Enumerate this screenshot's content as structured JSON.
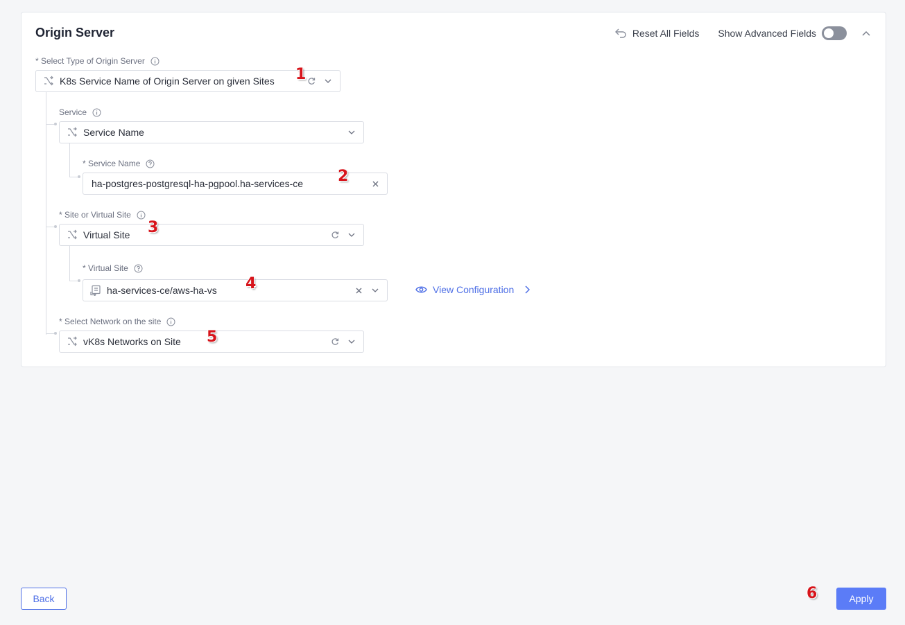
{
  "section": {
    "title": "Origin Server",
    "reset_label": "Reset All Fields",
    "advanced_label": "Show Advanced Fields",
    "advanced_enabled": false
  },
  "fields": {
    "origin_type": {
      "label": "* Select Type of Origin Server",
      "value": "K8s Service Name of Origin Server on given Sites"
    },
    "service": {
      "label": "Service",
      "value": "Service Name"
    },
    "service_name": {
      "label": "* Service Name",
      "value": "ha-postgres-postgresql-ha-pgpool.ha-services-ce"
    },
    "site_or_virtual": {
      "label": "* Site or Virtual Site",
      "value": "Virtual Site"
    },
    "virtual_site": {
      "label": "* Virtual Site",
      "value": "ha-services-ce/aws-ha-vs",
      "view_config_label": "View Configuration"
    },
    "network": {
      "label": "* Select Network on the site",
      "value": "vK8s Networks on Site"
    }
  },
  "markers": [
    "1",
    "2",
    "3",
    "4",
    "5",
    "6"
  ],
  "footer": {
    "back_label": "Back",
    "apply_label": "Apply"
  },
  "colors": {
    "accent": "#5b7cf7",
    "link": "#4e6fe6",
    "marker": "#d7141b"
  }
}
